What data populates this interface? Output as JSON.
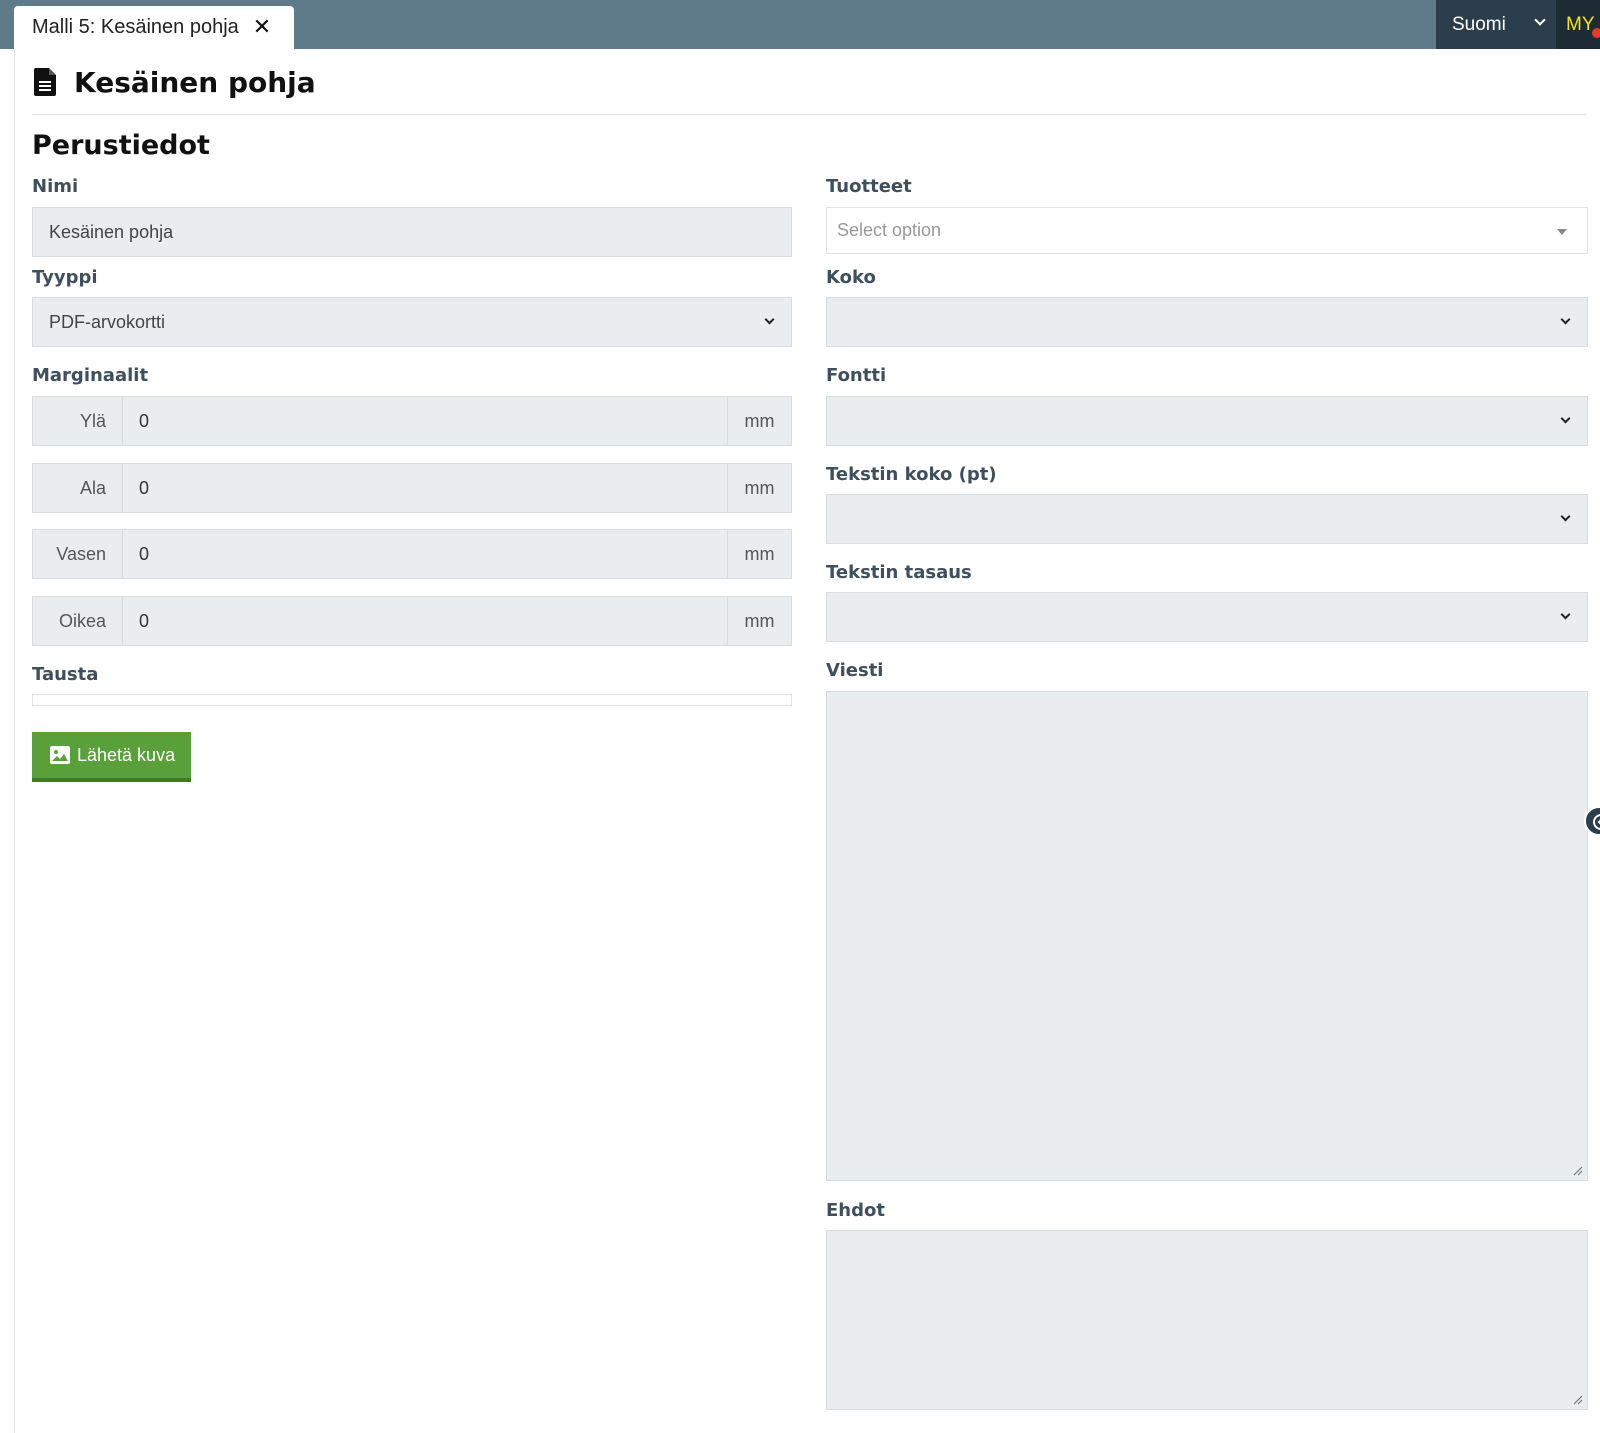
{
  "tab": {
    "label": "Malli 5: Kesäinen pohja",
    "close": "✕"
  },
  "topbar": {
    "language": "Suomi",
    "user_initials": "MY"
  },
  "page": {
    "title": "Kesäinen pohja",
    "section_title": "Perustiedot"
  },
  "form": {
    "nimi": {
      "label": "Nimi",
      "value": "Kesäinen pohja"
    },
    "tyyppi": {
      "label": "Tyyppi",
      "value": "PDF-arvokortti"
    },
    "marginaalit": {
      "label": "Marginaalit",
      "unit": "mm",
      "rows": [
        {
          "label": "Ylä",
          "value": "0"
        },
        {
          "label": "Ala",
          "value": "0"
        },
        {
          "label": "Vasen",
          "value": "0"
        },
        {
          "label": "Oikea",
          "value": "0"
        }
      ]
    },
    "tausta": {
      "label": "Tausta",
      "upload_button": "Lähetä kuva"
    },
    "tuotteet": {
      "label": "Tuotteet",
      "placeholder": "Select option"
    },
    "koko": {
      "label": "Koko",
      "value": ""
    },
    "fontti": {
      "label": "Fontti",
      "value": ""
    },
    "tekstin_koko": {
      "label": "Tekstin koko (pt)",
      "value": ""
    },
    "tekstin_tasaus": {
      "label": "Tekstin tasaus",
      "value": ""
    },
    "viesti": {
      "label": "Viesti",
      "value": ""
    },
    "ehdot": {
      "label": "Ehdot",
      "value": ""
    }
  },
  "colors": {
    "topbar": "#5f7b8a",
    "accent_button": "#5aa03a",
    "field_bg": "#e9edf0"
  }
}
